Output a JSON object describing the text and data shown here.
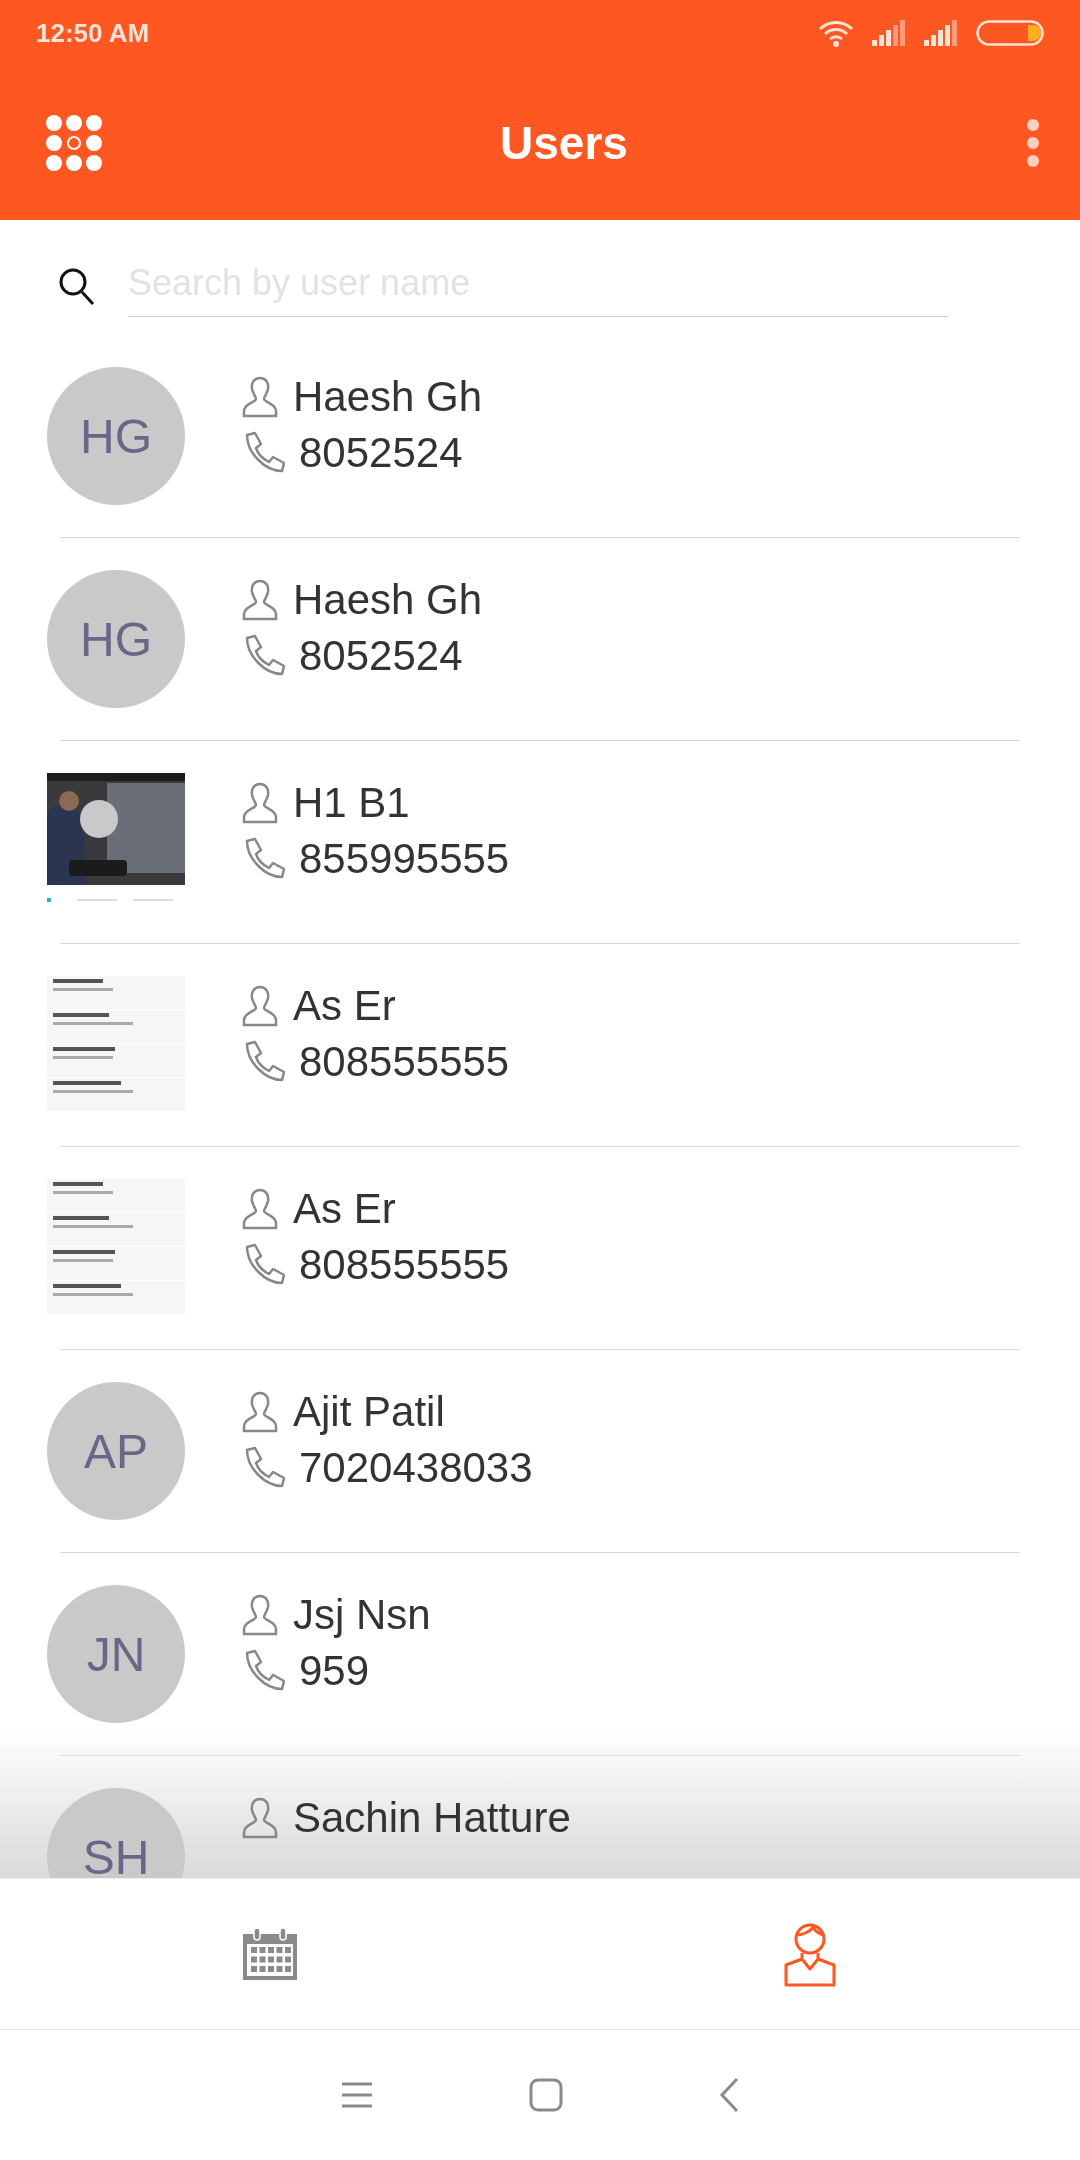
{
  "status_bar": {
    "time": "12:50 AM"
  },
  "app_bar": {
    "title": "Users"
  },
  "search": {
    "placeholder": "Search by user name"
  },
  "users": [
    {
      "avatar": {
        "kind": "initials",
        "text": "HG"
      },
      "name": "Haesh Gh",
      "phone": "8052524"
    },
    {
      "avatar": {
        "kind": "initials",
        "text": "HG"
      },
      "name": "Haesh Gh",
      "phone": "8052524"
    },
    {
      "name": "H1 B1",
      "phone": "855995555"
    },
    {
      "name": "As Er",
      "phone": "808555555"
    },
    {
      "name": "As Er",
      "phone": "808555555"
    },
    {
      "avatar": {
        "kind": "initials",
        "text": "AP"
      },
      "name": "Ajit Patil",
      "phone": "7020438033"
    },
    {
      "avatar": {
        "kind": "initials",
        "text": "JN"
      },
      "name": "Jsj Nsn",
      "phone": "959"
    },
    {
      "avatar": {
        "kind": "initials",
        "text": "SH"
      },
      "name": "Sachin Hatture"
    }
  ],
  "bottom_nav": [
    {
      "kind": "calendar",
      "selected": false
    },
    {
      "kind": "person",
      "selected": true
    }
  ]
}
